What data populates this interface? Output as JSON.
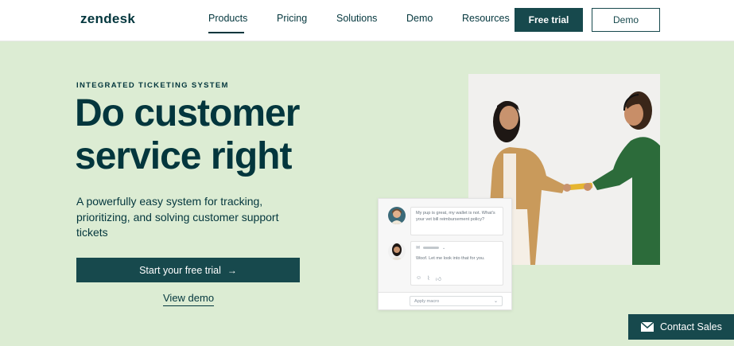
{
  "header": {
    "logo": "zendesk",
    "nav": [
      "Products",
      "Pricing",
      "Solutions",
      "Demo",
      "Resources"
    ],
    "active_nav": "Products",
    "free_trial_label": "Free trial",
    "demo_label": "Demo"
  },
  "hero": {
    "eyebrow": "INTEGRATED TICKETING SYSTEM",
    "headline": "Do customer service right",
    "subhead": "A powerfully easy system for tracking, prioritizing, and solving customer support tickets",
    "cta_label": "Start your free trial",
    "cta_arrow": "→",
    "secondary_link": "View demo"
  },
  "ticket_widget": {
    "customer_message": "My pup is great, my wallet is not. What's your vet bill reimbursement policy?",
    "agent_reply": "Woof. Let me look into that for you.",
    "macro_placeholder": "Apply macro"
  },
  "contact_sales_label": "Contact Sales",
  "colors": {
    "brand_dark": "#03363d",
    "button": "#17494d",
    "hero_bg": "#dcecd3"
  }
}
